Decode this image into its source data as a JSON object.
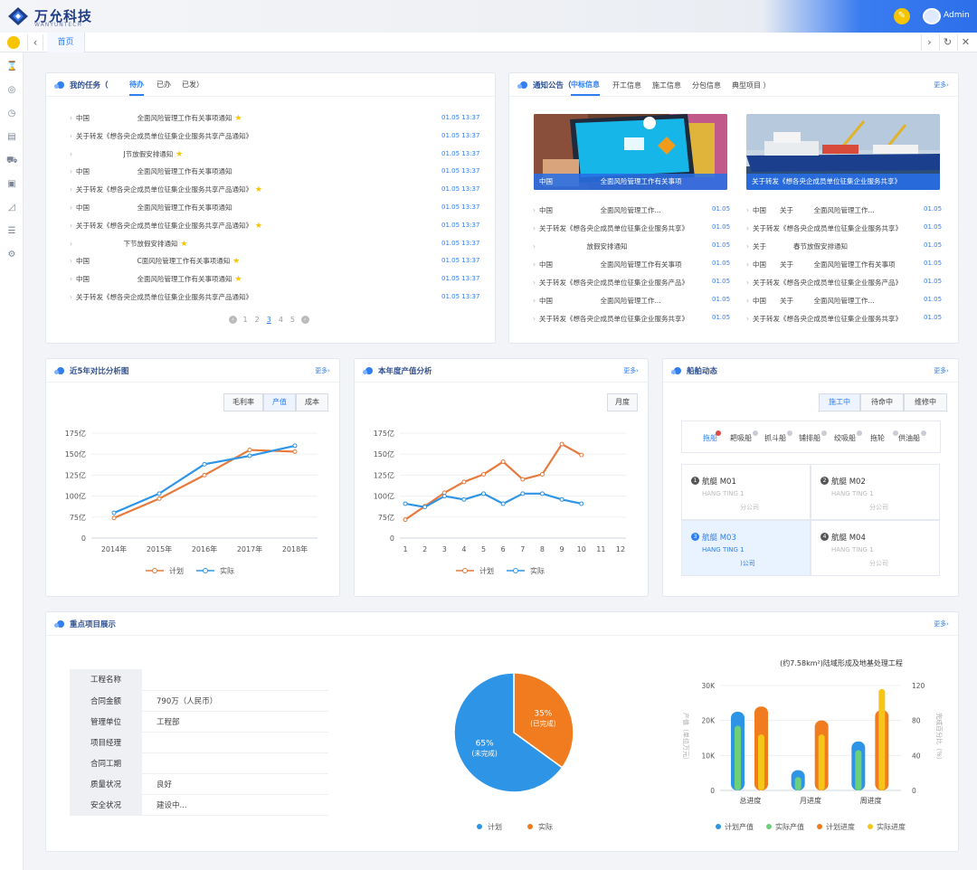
{
  "header": {
    "brand": "万允科技",
    "brand_sub": "WANYUNTECH",
    "user": "Admin",
    "edit_icon": "pencil-icon"
  },
  "tabs": {
    "home": "首页"
  },
  "tasks": {
    "title": "我的任务（",
    "tab_active": "待办",
    "tab_2": "已办",
    "tab_3": "已发）",
    "rows": [
      {
        "text": "中国　　　　　　　全面风险管理工作有关事项通知",
        "date": "01.05  13:37",
        "star": true
      },
      {
        "text": "关于转发《想各央企成员单位征集企业服务共享产品通知》",
        "date": "01.05  13:37",
        "star": false
      },
      {
        "text": "　　　　　　　J节放假安排通知",
        "date": "01.05  13:37",
        "star": true
      },
      {
        "text": "中国　　　　　　　全面风险管理工作有关事项通知",
        "date": "01.05  13:37",
        "star": false
      },
      {
        "text": "关于转发《想各央企成员单位征集企业服务共享产品通知》",
        "date": "01.05  13:37",
        "star": true
      },
      {
        "text": "中国　　　　　　　全面风险管理工作有关事项通知",
        "date": "01.05  13:37",
        "star": false
      },
      {
        "text": "关于转发《想各央企成员单位征集企业服务共享产品通知》",
        "date": "01.05  13:37",
        "star": true
      },
      {
        "text": "　　　　　　　下节放假安排通知",
        "date": "01.05  13:37",
        "star": true
      },
      {
        "text": "中国　　　　　　　C面风险管理工作有关事项通知",
        "date": "01.05  13:37",
        "star": true
      },
      {
        "text": "中国　　　　　　　全面风险管理工作有关事项通知",
        "date": "01.05  13:37",
        "star": true
      },
      {
        "text": "关于转发《想各央企成员单位征集企业服务共享产品通知》",
        "date": "01.05  13:37",
        "star": false
      }
    ],
    "pages": [
      "1",
      "2",
      "3",
      "4",
      "5"
    ],
    "current_page": "3"
  },
  "notices": {
    "title": "通知公告（",
    "tabs": [
      "中标信息",
      "开工信息",
      "施工信息",
      "分包信息",
      "典型项目 ）"
    ],
    "more": "更多›",
    "img1_caption": "中国　　　　　　　全面风险管理工作有关事项",
    "img2_caption": "关于转发《想各央企成员单位征集企业服务共享》",
    "col1": [
      {
        "text": "中国　　　　　　　全面风险管理工作...",
        "date": "01.05"
      },
      {
        "text": "关于转发《想各央企成员单位征集企业服务共享》",
        "date": "01.05"
      },
      {
        "text": "　　　　　　　放假安排通知",
        "date": "01.05"
      },
      {
        "text": "中国　　　　　　　全面风险管理工作有关事项",
        "date": "01.05"
      },
      {
        "text": "关于转发《想各央企成员单位征集企业服务产品》",
        "date": "01.05"
      },
      {
        "text": "中国　　　　　　　全面风险管理工作...",
        "date": "01.05"
      },
      {
        "text": "关于转发《想各央企成员单位征集企业服务共享》",
        "date": "01.05"
      }
    ],
    "col2": [
      {
        "text": "中国　　关于　　　全面风险管理工作...",
        "date": "01.05"
      },
      {
        "text": "关于转发《想各央企成员单位征集企业服务共享》",
        "date": "01.05"
      },
      {
        "text": "关于　　　　春节放假安排通知",
        "date": "01.05"
      },
      {
        "text": "中国　　关于　　　全面风险管理工作有关事项",
        "date": "01.05"
      },
      {
        "text": "关于转发《想各央企成员单位征集企业服务产品》",
        "date": "01.05"
      },
      {
        "text": "中国　　关于　　　全面风险管理工作...",
        "date": "01.05"
      },
      {
        "text": "关于转发《想各央企成员单位征集企业服务共享》",
        "date": "01.05"
      }
    ]
  },
  "comparison": {
    "title": "近5年对比分析图",
    "more": "更多›",
    "buttons": [
      "毛利率",
      "产值",
      "成本"
    ],
    "active_button": "产值"
  },
  "annual": {
    "title": "本年度产值分析",
    "more": "更多›",
    "button": "月度"
  },
  "ships": {
    "title": "船舶动态",
    "more": "更多›",
    "status_tabs": [
      "施工中",
      "待命中",
      "维修中"
    ],
    "types": [
      "拖船",
      "耙吸船",
      "抓斗船",
      "铺排船",
      "绞吸船",
      "拖轮",
      "供油船"
    ],
    "cells": [
      {
        "num": "1",
        "name": "航艇 M01",
        "sub": "HANG TING 1",
        "company": "　　　　　　分公司"
      },
      {
        "num": "2",
        "name": "航艇 M02",
        "sub": "HANG TING 1",
        "company": "　　　　　　分公司"
      },
      {
        "num": "3",
        "name": "航艇 M03",
        "sub": "HANG TING 1",
        "company": "　　　　　　)公司"
      },
      {
        "num": "4",
        "name": "航艇 M04",
        "sub": "HANG TING 1",
        "company": "　　　　　　分公司"
      }
    ]
  },
  "projects": {
    "title": "重点项目展示",
    "more": "更多›",
    "info": [
      {
        "k": "工程名称",
        "v": ""
      },
      {
        "k": "合同金额",
        "v": "790万（人民币）"
      },
      {
        "k": "管理单位",
        "v": "工程部"
      },
      {
        "k": "项目经理",
        "v": ""
      },
      {
        "k": "合同工期",
        "v": ""
      },
      {
        "k": "质量状况",
        "v": "良好"
      },
      {
        "k": "安全状况",
        "v": "建设中..."
      }
    ]
  },
  "colors": {
    "accent": "#2f7ff0",
    "plan": "#e67a3c",
    "actual": "#2e95e6",
    "green": "#6ad17a",
    "yellow": "#f5c518"
  },
  "chart_data": [
    {
      "type": "line",
      "title": "近5年对比分析图",
      "x": [
        "2014年",
        "2015年",
        "2016年",
        "2017年",
        "2018年"
      ],
      "y_ticks": [
        "0",
        "75亿",
        "100亿",
        "125亿",
        "150亿",
        "175亿"
      ],
      "ylim": [
        50,
        175
      ],
      "series": [
        {
          "name": "计划",
          "color": "#e67a3c",
          "values": [
            74,
            97,
            125,
            155,
            153
          ]
        },
        {
          "name": "实际",
          "color": "#2e95e6",
          "values": [
            80,
            103,
            138,
            148,
            160
          ]
        }
      ],
      "legend": "bottom"
    },
    {
      "type": "line",
      "title": "本年度产值分析",
      "x": [
        "1",
        "2",
        "3",
        "4",
        "5",
        "6",
        "7",
        "8",
        "9",
        "10",
        "11",
        "12"
      ],
      "y_ticks": [
        "0",
        "75亿",
        "100亿",
        "125亿",
        "150亿",
        "175亿"
      ],
      "ylim": [
        50,
        175
      ],
      "series": [
        {
          "name": "计划",
          "color": "#e67a3c",
          "values": [
            72,
            88,
            104,
            117,
            126,
            141,
            120,
            126,
            162,
            149,
            null,
            null
          ]
        },
        {
          "name": "实际",
          "color": "#2e95e6",
          "values": [
            91,
            87,
            100,
            96,
            103,
            91,
            103,
            103,
            96,
            91,
            null,
            null
          ]
        }
      ],
      "legend": "bottom"
    },
    {
      "type": "pie",
      "labels": [
        "计划",
        "实际"
      ],
      "slice_labels": [
        "65%\n(未完成)",
        "35%\n(已完成)"
      ],
      "values": [
        65,
        35
      ],
      "colors": [
        "#2e95e6",
        "#f07c1f"
      ],
      "legend": "bottom"
    },
    {
      "type": "bar",
      "title": "(约7.58km²)陆域形成及地基处理工程",
      "categories": [
        "总进度",
        "月进度",
        "周进度"
      ],
      "y_ticks_left": [
        "0",
        "10K",
        "20K",
        "30K"
      ],
      "y_ticks_right": [
        "0",
        "40",
        "80",
        "120"
      ],
      "ylim": [
        0,
        30000
      ],
      "y2lim": [
        0,
        120
      ],
      "ylabel": "产值（单位万元）",
      "y2label": "完成百分比（%）",
      "series": [
        {
          "name": "计划产值",
          "color": "#2e95e6",
          "axis": "left",
          "values": [
            22500,
            5800,
            14000
          ]
        },
        {
          "name": "实际产值",
          "color": "#6ad17a",
          "axis": "left",
          "values": [
            18500,
            3800,
            11500
          ]
        },
        {
          "name": "计划进度",
          "color": "#f07c1f",
          "axis": "right",
          "values": [
            96,
            80,
            92
          ]
        },
        {
          "name": "实际进度",
          "color": "#f5c518",
          "axis": "right",
          "values": [
            64,
            64,
            116
          ]
        }
      ],
      "legend": "bottom"
    }
  ]
}
